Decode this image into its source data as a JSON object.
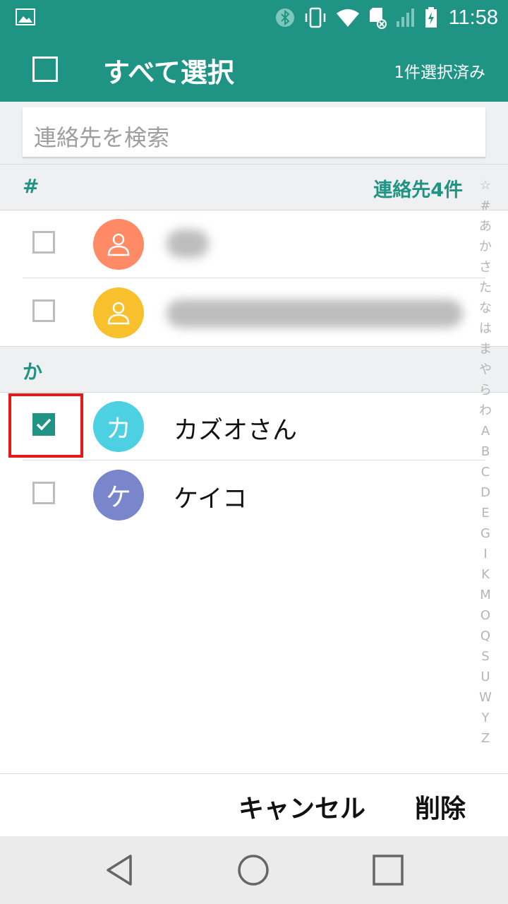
{
  "status_bar": {
    "time": "11:58",
    "icons": [
      "image-icon",
      "bluetooth-icon",
      "vibrate-icon",
      "wifi-icon",
      "sd-card-icon",
      "signal-icon",
      "battery-charging-icon"
    ]
  },
  "app_bar": {
    "select_all_label": "すべて選択",
    "selected_count": "1件選択済み"
  },
  "search": {
    "placeholder": "連絡先を検索"
  },
  "sections": [
    {
      "label": "#",
      "count_label": "連絡先4件",
      "contacts": [
        {
          "name": "",
          "avatar_color": "#FF8A65",
          "avatar_icon": "person-icon",
          "checked": false
        },
        {
          "name": "",
          "avatar_color": "#F7C02C",
          "avatar_icon": "person-icon",
          "checked": false
        }
      ]
    },
    {
      "label": "か",
      "contacts": [
        {
          "name": "カズオさん",
          "avatar_letter": "カ",
          "avatar_color": "#4DD0E1",
          "checked": true
        },
        {
          "name": "ケイコ",
          "avatar_letter": "ケ",
          "avatar_color": "#7986CB",
          "checked": false
        }
      ]
    }
  ],
  "index_bar": [
    "☆",
    "#",
    "あ",
    "か",
    "さ",
    "た",
    "な",
    "は",
    "ま",
    "や",
    "ら",
    "わ",
    "A",
    "B",
    "C",
    "D",
    "E",
    "G",
    "I",
    "K",
    "M",
    "O",
    "Q",
    "S",
    "U",
    "W",
    "Y",
    "Z"
  ],
  "bottom_actions": {
    "cancel_label": "キャンセル",
    "delete_label": "削除"
  },
  "colors": {
    "primary": "#209484",
    "highlight": "#E81818"
  }
}
